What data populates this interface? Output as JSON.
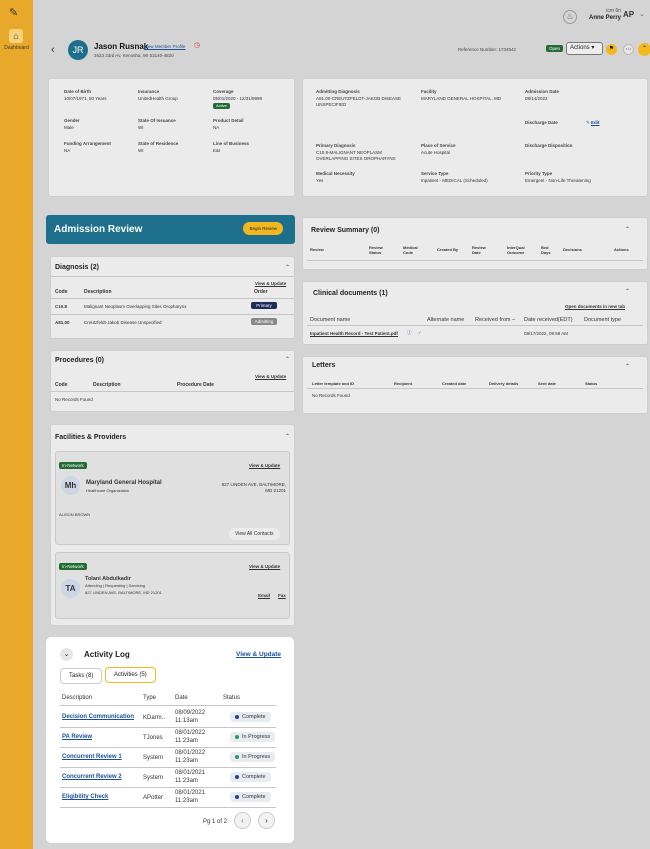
{
  "sidebar": {
    "logo_icon": "app-logo-icon",
    "home_icon": "home-icon",
    "dashboard_label": "Dashboard"
  },
  "topbar": {
    "user_line1": "icm 6n",
    "user_line2": "Anne Perry",
    "user_initials": "AP"
  },
  "member": {
    "initials": "JR",
    "name": "Jason Rusnak",
    "profile_link": "View Member Profile",
    "address": "2623 23rd Av, Kenosha, WI 53140-4820",
    "reference": "Reference Number: 1734542",
    "status": "Open",
    "actions": "Actions ▾"
  },
  "details": {
    "dob_label": "Date of Birth",
    "dob": "10/07/1971, 50 Years",
    "insurance_label": "Insurance",
    "insurance": "UnitedHealth Group",
    "coverage_label": "Coverage",
    "coverage": "05/01/2020 - 12/31/9999",
    "coverage_status": "Active",
    "gender_label": "Gender",
    "gender": "Male",
    "state_issue_label": "State Of Issuance",
    "state_issue": "WI",
    "product_label": "Product Detail",
    "product": "NA",
    "funding_label": "Funding Arrangement",
    "funding": "NA",
    "state_res_label": "State of Residence",
    "state_res": "WI",
    "lob_label": "Line of Business",
    "lob": "E&I",
    "adm_diag_label": "Admitting Diagnosis",
    "adm_diag": "A81.00-CREUTZFELDT-JAKOB DISEASE UNSPECIFIED",
    "facility_label": "Facility",
    "facility": "MARYLAND GENERAL HOSPITAL, MD",
    "adm_date_label": "Admission Date",
    "adm_date": "08/14/2022",
    "discharge_label": "Discharge Date",
    "edit": "Edit",
    "prim_diag_label": "Primary Diagnosis",
    "prim_diag": "C10.8-MALIGNANT NEOPLASM OVERLAPPING SITES OROPHARYNX",
    "pos_label": "Place of Service",
    "pos": "Acute Hospital",
    "dispo_label": "Discharge Disposition",
    "necessity_label": "Medical Necessity",
    "necessity": "Yes",
    "svc_label": "Service Type",
    "svc": "Inpatient - MEDICAL (Scheduled)",
    "priority_label": "Priority Type",
    "priority": "Emergent - Non-Life Threatening"
  },
  "admission": {
    "title": "Admission Review",
    "begin": "Begin Review"
  },
  "diagnosis": {
    "title": "Diagnosis (2)",
    "view_update": "View & Update",
    "col_code": "Code",
    "col_desc": "Description",
    "col_order": "Order",
    "rows": [
      {
        "code": "C10.8",
        "desc": "Malignant Neoplasm Overlapping Sites Oropharynx",
        "order": "Primary"
      },
      {
        "code": "A81.00",
        "desc": "Creutzfeldt-Jakob Disease Unspecified",
        "order": "Admitting"
      }
    ]
  },
  "procedures": {
    "title": "Procedures (0)",
    "view_update": "View & Update",
    "col_code": "Code",
    "col_desc": "Description",
    "col_date": "Procedure Date",
    "empty": "No Records Found"
  },
  "facilities": {
    "title": "Facilities & Providers",
    "card1": {
      "badge": "In-Network",
      "link": "View & Update",
      "initials": "Mh",
      "name": "Maryland General Hospital",
      "type": "Healthcare Organization",
      "address": "827 LINDEN AVE, BALTIMORE, MD 21201",
      "contact": "ALISON BROWN",
      "contacts_btn": "View All Contacts"
    },
    "card2": {
      "badge": "In-Network",
      "link": "View & Update",
      "initials": "TA",
      "name": "Tolani Abdulkadir",
      "roles": "Attending | Requesting | Servicing",
      "address": "827 LINDEN AVE, BALTIMORE, MD 21201",
      "email": "Email",
      "fax": "Fax"
    }
  },
  "activity": {
    "title": "Activity Log",
    "view_update": "View & Update",
    "tab_tasks": "Tasks (8)",
    "tab_acts": "Activities (5)",
    "col_desc": "Description",
    "col_type": "Type",
    "col_date": "Date",
    "col_status": "Status",
    "rows": [
      {
        "desc": "Decision Communication",
        "type": "KDarm..",
        "date1": "08/09/2022",
        "date2": "11:13am",
        "status": "Complete",
        "dot": "#1f3fa3"
      },
      {
        "desc": "PA Review",
        "type": "TJones",
        "date1": "08/01/2022",
        "date2": "11:23am",
        "status": "In Progress",
        "dot": "#2a9a55"
      },
      {
        "desc": "Concurrent Review 1",
        "type": "System",
        "date1": "08/01/2022",
        "date2": "11:23am",
        "status": "In Progress",
        "dot": "#2a9a55"
      },
      {
        "desc": "Concurrent Review 2",
        "type": "System",
        "date1": "08/01/2021",
        "date2": "11:23am",
        "status": "Complete",
        "dot": "#1f3fa3"
      },
      {
        "desc": "Eligibility Check",
        "type": "APotter",
        "date1": "08/01/2021",
        "date2": "11:23am",
        "status": "Complete",
        "dot": "#1f3fa3"
      }
    ],
    "page": "Pg 1 of 2"
  },
  "review_summary": {
    "title": "Review Summary (0)",
    "cols": [
      "Review",
      "Review Status",
      "Medical Code",
      "Created By",
      "Review Date",
      "InterQual Outcome",
      "Bed Days",
      "Decisions",
      "Actions"
    ]
  },
  "clinical": {
    "title": "Clinical documents (1)",
    "open_new": "Open documents in new tab",
    "col_name": "Document name",
    "col_alt": "Alternate name",
    "col_from": "Received from –",
    "col_date": "Date received(EDT)",
    "col_type": "Document type",
    "doc": "Inpatient Health Record - Test Patient.pdf",
    "doc_date": "08/17/2022, 09:58 AM"
  },
  "letters": {
    "title": "Letters",
    "cols": [
      "Letter template and ID",
      "Recipient",
      "Created date",
      "Delivery details",
      "Sent date",
      "Status"
    ],
    "empty": "No Records Found"
  }
}
